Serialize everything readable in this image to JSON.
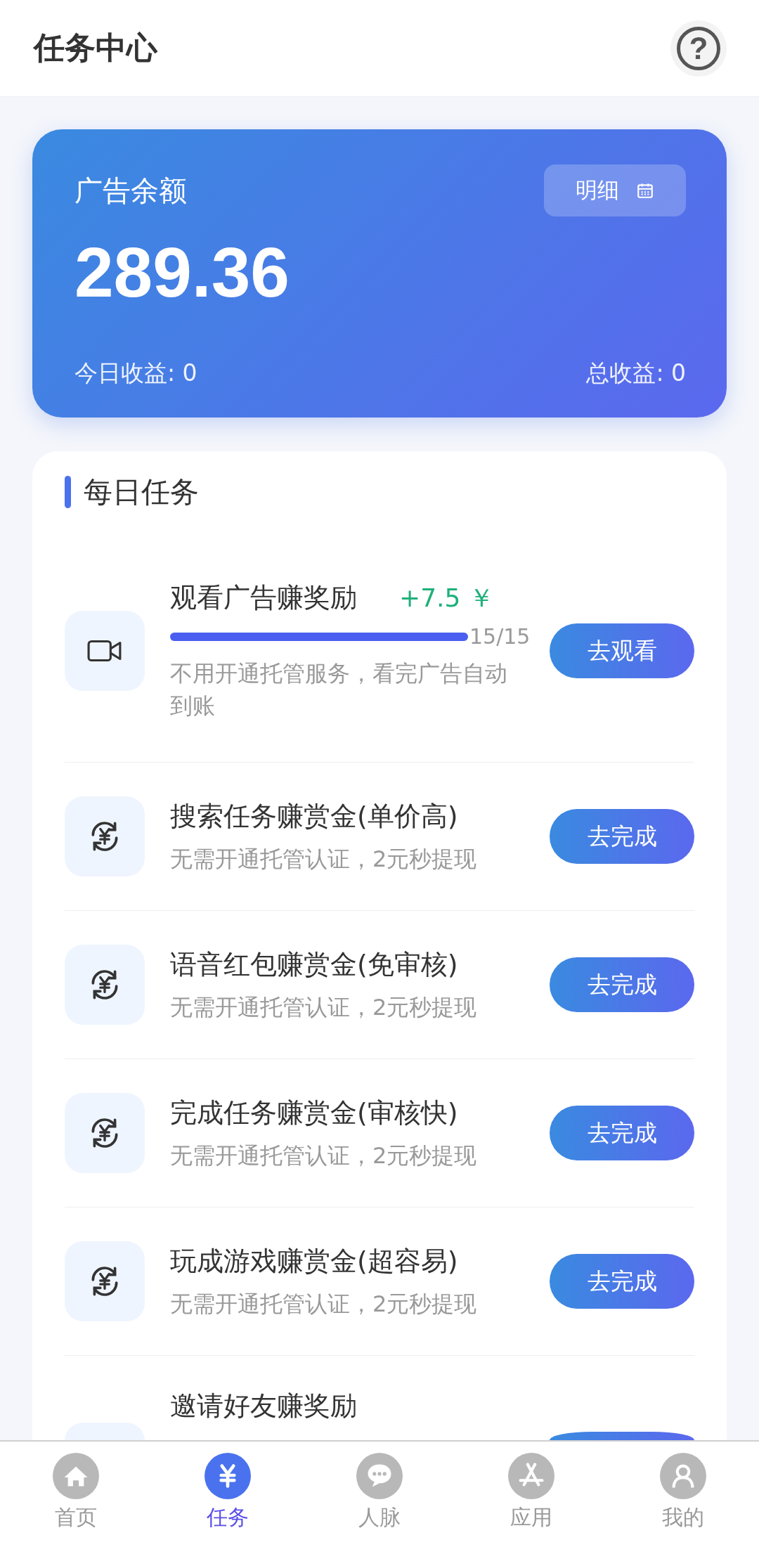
{
  "header": {
    "title": "任务中心",
    "help": "?"
  },
  "balance": {
    "label": "广告余额",
    "amount": "289.36",
    "detail_button": "明细",
    "today": "今日收益: 0",
    "total": "总收益: 0"
  },
  "daily_tasks": {
    "title": "每日任务",
    "tasks": [
      {
        "kind": "progress",
        "title": "观看广告赚奖励",
        "reward": "+7.5 ￥",
        "level": 1,
        "count": "15/15",
        "description": "不用开通托管服务，看完广告自动到账",
        "button": "去观看"
      },
      {
        "kind": "simple",
        "title": "搜索任务赚赏金(单价高)",
        "description": "无需开通托管认证，2元秒提现",
        "button": "去完成"
      },
      {
        "kind": "simple",
        "title": "语音红包赚赏金(免审核)",
        "description": "无需开通托管认证，2元秒提现",
        "button": "去完成"
      },
      {
        "kind": "simple",
        "title": "完成任务赚赏金(审核快)",
        "description": "无需开通托管认证，2元秒提现",
        "button": "去完成"
      },
      {
        "kind": "simple",
        "title": "玩成游戏赚赏金(超容易)",
        "description": "无需开通托管认证，2元秒提现",
        "button": "去完成"
      },
      {
        "kind": "simple",
        "title": "邀请好友赚奖励"
      }
    ]
  },
  "tab_bar": [
    {
      "label": "首页",
      "kind": "home",
      "selected": false
    },
    {
      "label": "任务",
      "kind": "yuan",
      "selected": true
    },
    {
      "label": "人脉",
      "kind": "chat",
      "selected": false
    },
    {
      "label": "应用",
      "kind": "apps",
      "selected": false
    },
    {
      "label": "我的",
      "kind": "person",
      "selected": false
    }
  ]
}
